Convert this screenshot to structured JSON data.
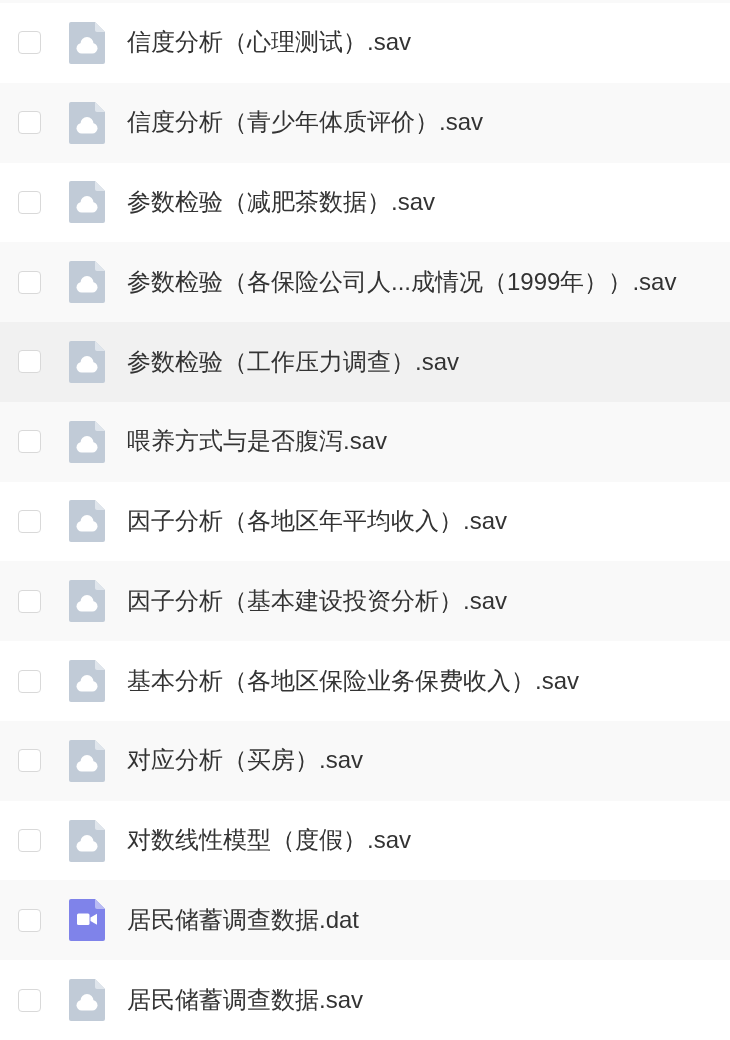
{
  "files": [
    {
      "name": "信度分析（心理测试）.sav",
      "kind": "cloud",
      "checked": false,
      "hovered": false
    },
    {
      "name": "信度分析（青少年体质评价）.sav",
      "kind": "cloud",
      "checked": false,
      "hovered": false
    },
    {
      "name": "参数检验（减肥茶数据）.sav",
      "kind": "cloud",
      "checked": false,
      "hovered": false
    },
    {
      "name": "参数检验（各保险公司人...成情况（1999年））.sav",
      "kind": "cloud",
      "checked": false,
      "hovered": false
    },
    {
      "name": "参数检验（工作压力调查）.sav",
      "kind": "cloud",
      "checked": false,
      "hovered": true
    },
    {
      "name": "喂养方式与是否腹泻.sav",
      "kind": "cloud",
      "checked": false,
      "hovered": false
    },
    {
      "name": "因子分析（各地区年平均收入）.sav",
      "kind": "cloud",
      "checked": false,
      "hovered": false
    },
    {
      "name": "因子分析（基本建设投资分析）.sav",
      "kind": "cloud",
      "checked": false,
      "hovered": false
    },
    {
      "name": "基本分析（各地区保险业务保费收入）.sav",
      "kind": "cloud",
      "checked": false,
      "hovered": false
    },
    {
      "name": "对应分析（买房）.sav",
      "kind": "cloud",
      "checked": false,
      "hovered": false
    },
    {
      "name": "对数线性模型（度假）.sav",
      "kind": "cloud",
      "checked": false,
      "hovered": false
    },
    {
      "name": "居民储蓄调查数据.dat",
      "kind": "video",
      "checked": false,
      "hovered": false
    },
    {
      "name": "居民储蓄调查数据.sav",
      "kind": "cloud",
      "checked": false,
      "hovered": false
    }
  ]
}
